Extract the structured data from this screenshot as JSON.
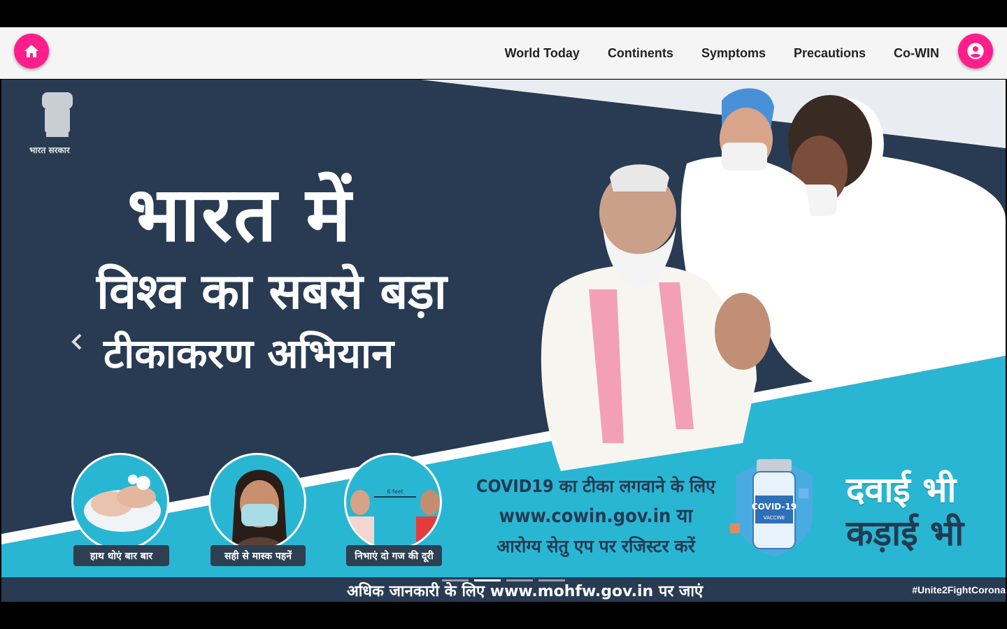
{
  "nav": {
    "home_icon": "home-icon",
    "account_icon": "account-circle-icon",
    "links": [
      "World Today",
      "Continents",
      "Symptoms",
      "Precautions",
      "Co-WIN"
    ],
    "accent_color": "#ff1e8c"
  },
  "banner": {
    "gov_label": "भारत सरकार",
    "title_line1": "भारत में",
    "title_line2": "विश्व का सबसे बड़ा",
    "title_line3": "टीकाकरण अभियान",
    "precautions": [
      {
        "label": "हाथ धोएं बार बार",
        "icon": "hand-wash-icon"
      },
      {
        "label": "सही से मास्क पहनें",
        "icon": "face-mask-icon"
      },
      {
        "label": "निभाएं दो गज की दूरी",
        "icon": "social-distance-icon"
      }
    ],
    "distance_label": "6 feet",
    "register_line1": "COVID19 का टीका लगवाने के लिए",
    "register_line2": "www.cowin.gov.in या",
    "register_line3": "आरोग्य सेतु एप पर रजिस्टर करें",
    "vaccine_label": "COVID-19",
    "vaccine_sublabel": "VACCINE",
    "slogan_line1": "दवाई भी",
    "slogan_line2": "कड़ाई भी",
    "footer_text": "अधिक जानकारी के लिए www.mohfw.gov.in पर जाएं",
    "hashtag": "#Unite2FightCorona",
    "colors": {
      "navy": "#283b52",
      "teal": "#29b6d3"
    }
  },
  "carousel": {
    "slide_count": 4,
    "active_index": 1,
    "prev_icon": "chevron-left-icon",
    "next_icon": "chevron-right-icon"
  }
}
